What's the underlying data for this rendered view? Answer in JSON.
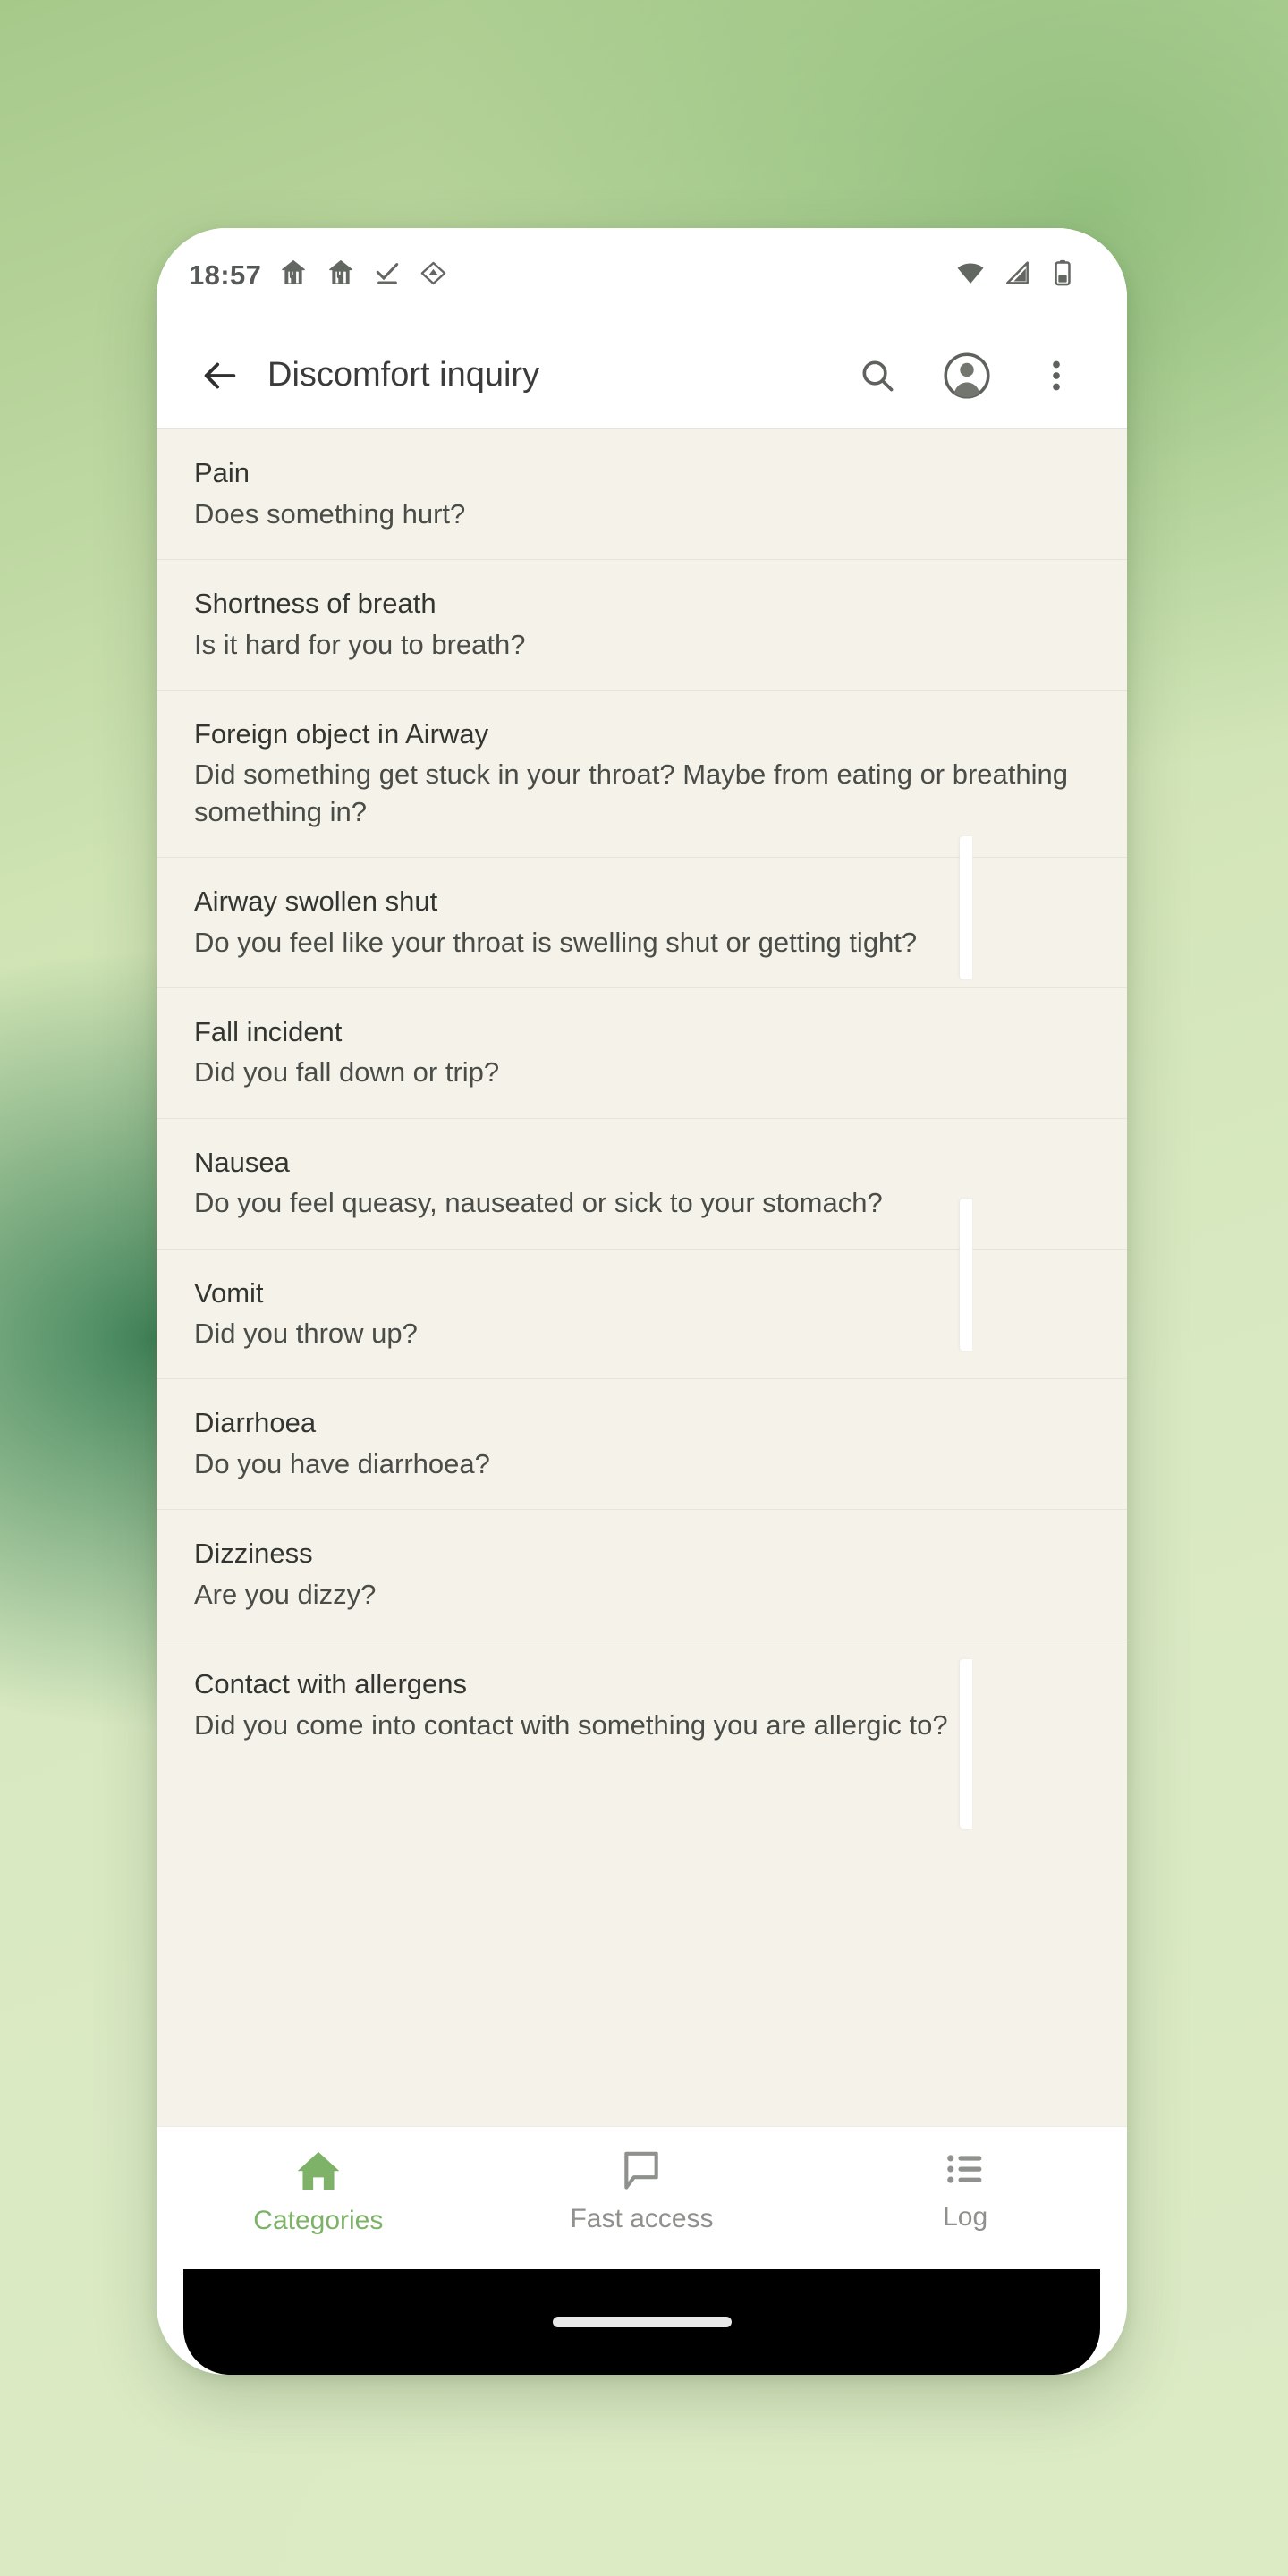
{
  "status_bar": {
    "time": "18:57",
    "left_icons": [
      "restaurant-icon",
      "restaurant-icon",
      "task-done-icon",
      "drive-icon"
    ],
    "right_icons": [
      "wifi-icon",
      "cellular-signal-icon",
      "battery-icon"
    ]
  },
  "app_bar": {
    "back_label": "back-arrow",
    "title": "Discomfort inquiry",
    "actions": [
      "search-icon",
      "account-avatar-icon",
      "overflow-menu-icon"
    ]
  },
  "list": {
    "items": [
      {
        "title": "Pain",
        "subtitle": "Does something hurt?"
      },
      {
        "title": "Shortness of breath",
        "subtitle": "Is it hard for you to breath?"
      },
      {
        "title": "Foreign object in Airway",
        "subtitle": "Did something get stuck in your throat? Maybe from eating or breathing something in?"
      },
      {
        "title": "Airway swollen shut",
        "subtitle": "Do you feel like your throat is swelling shut or getting tight?"
      },
      {
        "title": "Fall incident",
        "subtitle": "Did you fall down or trip?"
      },
      {
        "title": "Nausea",
        "subtitle": "Do you feel queasy, nauseated or sick to your stomach?"
      },
      {
        "title": "Vomit",
        "subtitle": "Did you throw up?"
      },
      {
        "title": "Diarrhoea",
        "subtitle": "Do you have diarrhoea?"
      },
      {
        "title": "Dizziness",
        "subtitle": "Are you dizzy?"
      },
      {
        "title": "Contact with allergens",
        "subtitle": "Did you come into contact with something you are allergic to?"
      }
    ]
  },
  "bottom_nav": {
    "items": [
      {
        "label": "Categories",
        "icon": "home-icon",
        "active": true
      },
      {
        "label": "Fast access",
        "icon": "speech-bubble-icon",
        "active": false
      },
      {
        "label": "Log",
        "icon": "list-icon",
        "active": false
      }
    ]
  },
  "colors": {
    "accent_green": "#7fb269",
    "list_background": "#f5f2ea",
    "app_bar_background": "#ffffff",
    "icon_grey": "#6e716c",
    "inactive_nav": "#8e918c"
  }
}
